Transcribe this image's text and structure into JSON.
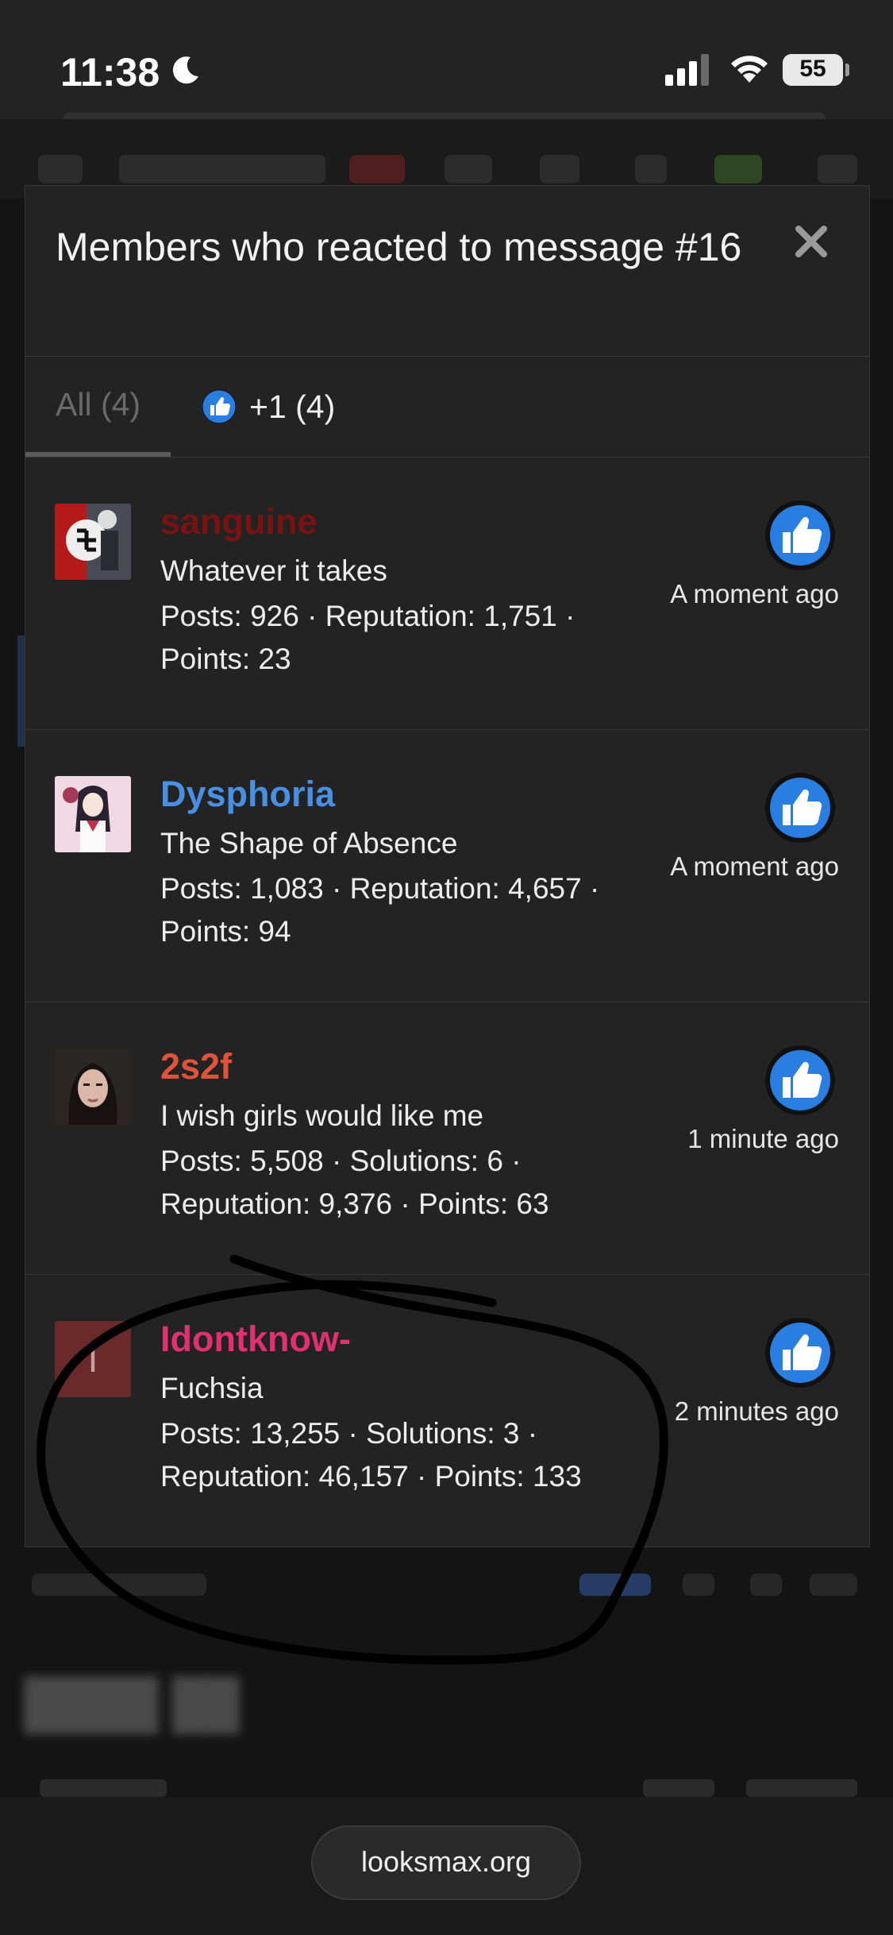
{
  "status_bar": {
    "time": "11:38",
    "battery": "55"
  },
  "modal": {
    "title": "Members who reacted to message #16",
    "tabs": [
      {
        "label": "All (4)"
      },
      {
        "label": "+1 (4)"
      }
    ]
  },
  "reactions": [
    {
      "name": "sanguine",
      "name_color": "#7a1212",
      "user_title": "Whatever it takes",
      "stats_line1": "Posts: 926 · Reputation: 1,751 ·",
      "stats_line2": "Points: 23",
      "time": "A moment ago"
    },
    {
      "name": "Dysphoria",
      "name_color": "#4a90e2",
      "user_title": "The Shape of Absence",
      "stats_line1": "Posts: 1,083 · Reputation: 4,657 ·",
      "stats_line2": "Points: 94",
      "time": "A moment ago"
    },
    {
      "name": "2s2f",
      "name_color": "#e0523a",
      "user_title": "I wish girls would like me",
      "stats_line1": "Posts: 5,508 · Solutions: 6 ·",
      "stats_line2": "Reputation: 9,376 · Points: 63",
      "time": "1 minute ago"
    },
    {
      "name": "Idontknow-",
      "name_color": "#e0306e",
      "user_title": "Fuchsia",
      "avatar_letter": "I",
      "stats_line1": "Posts: 13,255 · Solutions: 3 ·",
      "stats_line2": "Reputation: 46,157 · Points: 133",
      "time": "2 minutes ago"
    }
  ],
  "bottom_bar": {
    "url": "looksmax.org"
  }
}
